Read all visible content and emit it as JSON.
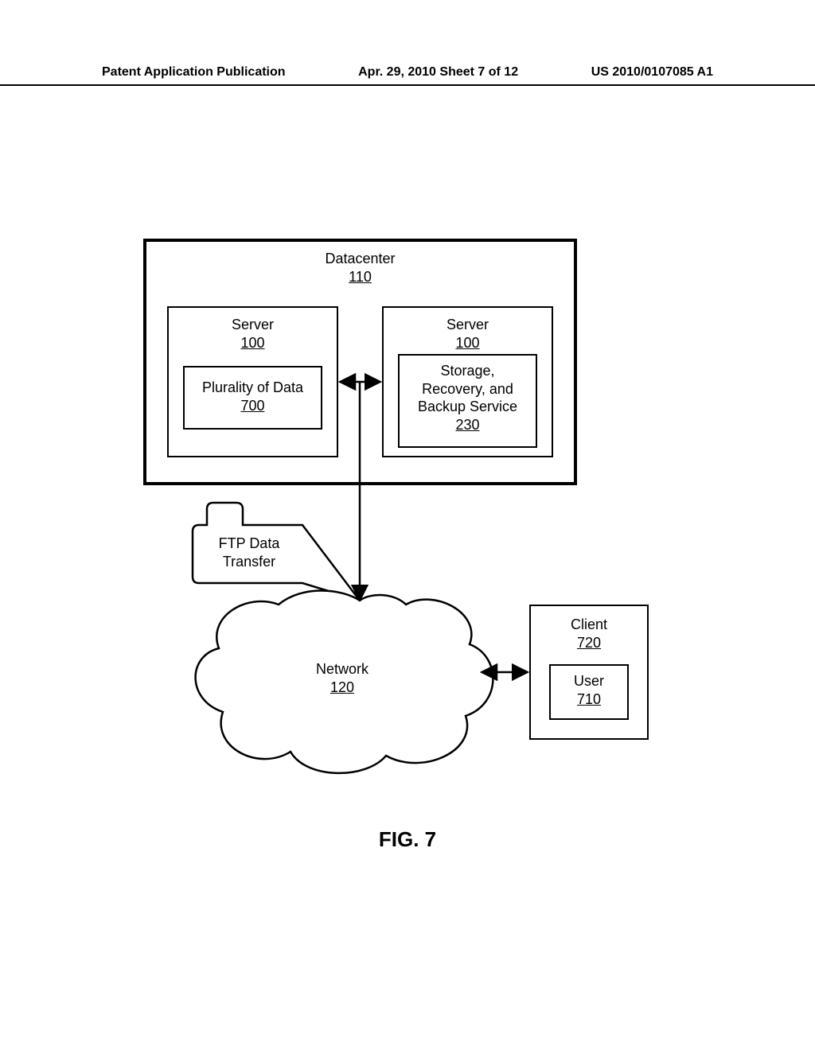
{
  "header": {
    "left": "Patent Application Publication",
    "center": "Apr. 29, 2010  Sheet 7 of 12",
    "right": "US 2010/0107085 A1"
  },
  "datacenter": {
    "title": "Datacenter",
    "ref": "110"
  },
  "server_left": {
    "title": "Server",
    "ref": "100",
    "inner_title": "Plurality of Data",
    "inner_ref": "700"
  },
  "server_right": {
    "title": "Server",
    "ref": "100",
    "inner_title1": "Storage,",
    "inner_title2": "Recovery, and",
    "inner_title3": "Backup Service",
    "inner_ref": "230"
  },
  "ftp": {
    "line1": "FTP Data",
    "line2": "Transfer"
  },
  "network": {
    "title": "Network",
    "ref": "120"
  },
  "client": {
    "title": "Client",
    "ref": "720",
    "user_title": "User",
    "user_ref": "710"
  },
  "figure_caption": "FIG. 7"
}
